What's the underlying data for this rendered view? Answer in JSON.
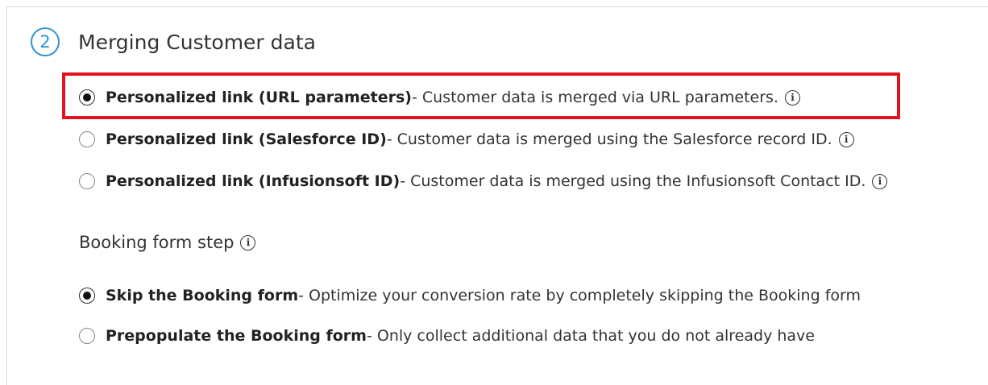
{
  "step": {
    "number": "2",
    "title": "Merging Customer data"
  },
  "merge_options": [
    {
      "label": "Personalized link (URL parameters)",
      "description": " - Customer data is merged via URL parameters.",
      "checked": true
    },
    {
      "label": "Personalized link (Salesforce ID)",
      "description": " - Customer data is merged using the Salesforce record ID.",
      "checked": false
    },
    {
      "label": "Personalized link (Infusionsoft ID)",
      "description": " - Customer data is merged using the Infusionsoft Contact ID.",
      "checked": false
    }
  ],
  "booking": {
    "label": "Booking form step",
    "options": [
      {
        "label": "Skip the Booking form",
        "description": " - Optimize your conversion rate by completely skipping the Booking form",
        "checked": true
      },
      {
        "label": "Prepopulate the Booking form",
        "description": " - Only collect additional data that you do not already have",
        "checked": false
      }
    ]
  },
  "icons": {
    "info": "info-icon",
    "info_glyph": "i"
  },
  "colors": {
    "accent": "#2f93d1",
    "highlight": "#e0141e"
  }
}
